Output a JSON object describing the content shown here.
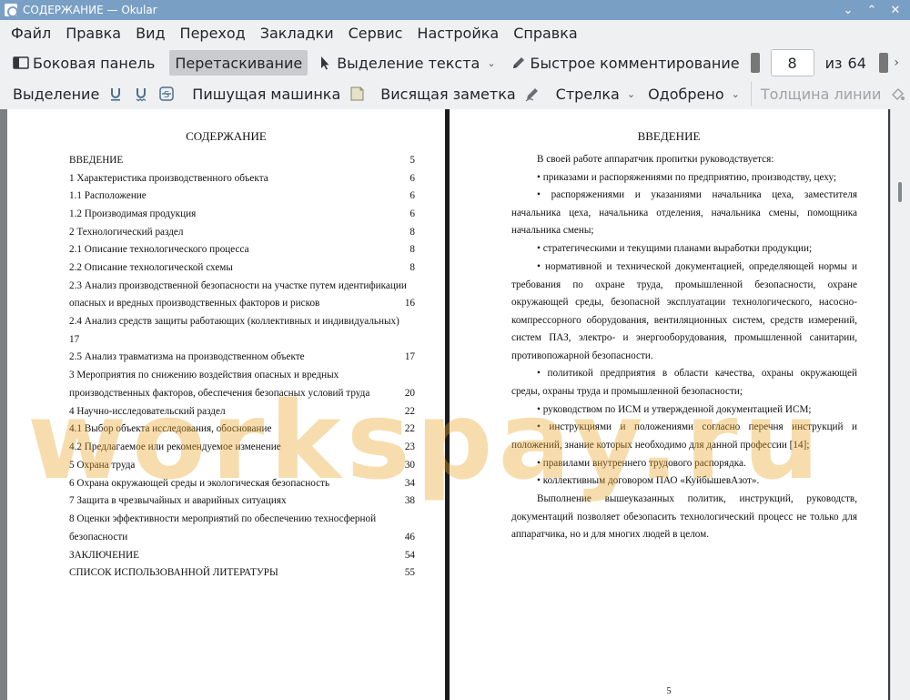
{
  "window": {
    "title": "СОДЕРЖАНИЕ  — Okular",
    "minimize": "⌄",
    "maximize": "⌃",
    "close": "✕"
  },
  "menu": [
    "Файл",
    "Правка",
    "Вид",
    "Переход",
    "Закладки",
    "Сервис",
    "Настройка",
    "Справка"
  ],
  "toolbar1": {
    "sidebar": "Боковая панель",
    "drag": "Перетаскивание",
    "text_select": "Выделение текста",
    "quick_comment": "Быстрое комментирование",
    "page_current": "8",
    "of": "из",
    "page_total": "64"
  },
  "toolbar2": {
    "selection": "Выделение",
    "typewriter": "Пишущая машинка",
    "hanging_note": "Висящая заметка",
    "arrow": "Стрелка",
    "stamp": "Одобрено",
    "line_width": "Толщина линии"
  },
  "left_page": {
    "title": "СОДЕРЖАНИЕ",
    "toc": [
      {
        "text": "ВВЕДЕНИЕ",
        "page": "5"
      },
      {
        "text": "1 Характеристика производственного объекта",
        "page": "6"
      },
      {
        "text": "1.1 Расположение",
        "page": "6"
      },
      {
        "text": "1.2 Производимая продукция",
        "page": "6"
      },
      {
        "text": "2 Технологический раздел",
        "page": "8"
      },
      {
        "text": "2.1 Описание технологического процесса",
        "page": "8"
      },
      {
        "text": "2.2 Описание технологической схемы",
        "page": "8"
      },
      {
        "text": "2.3 Анализ производственной безопасности на участке путем идентификации",
        "page": ""
      },
      {
        "text": "опасных и вредных производственных факторов и рисков",
        "page": "16"
      },
      {
        "text": "2.4 Анализ средств защиты работающих (коллективных и индивидуальных)",
        "page": ""
      },
      {
        "text": "17",
        "page": ""
      },
      {
        "text": "2.5 Анализ травматизма на производственном объекте",
        "page": "17"
      },
      {
        "text": "3 Мероприятия по снижению воздействия опасных и вредных",
        "page": ""
      },
      {
        "text": "производственных факторов, обеспечения безопасных условий труда",
        "page": "20"
      },
      {
        "text": "4 Научно-исследовательский раздел",
        "page": "22"
      },
      {
        "text": "4.1 Выбор объекта исследования, обоснование",
        "page": "22"
      },
      {
        "text": "4.2 Предлагаемое или рекомендуемое изменение",
        "page": "23"
      },
      {
        "text": "5 Охрана труда",
        "page": "30"
      },
      {
        "text": "6 Охрана окружающей среды и экологическая безопасность",
        "page": "34"
      },
      {
        "text": "7 Защита в чрезвычайных и аварийных ситуациях",
        "page": "38"
      },
      {
        "text": "8 Оценки эффективности мероприятий по обеспечению техносферной",
        "page": ""
      },
      {
        "text": "безопасности",
        "page": "46"
      },
      {
        "text": "ЗАКЛЮЧЕНИЕ",
        "page": "54"
      },
      {
        "text": "СПИСОК ИСПОЛЬЗОВАННОЙ ЛИТЕРАТУРЫ",
        "page": "55"
      }
    ]
  },
  "right_page": {
    "title": "ВВЕДЕНИЕ",
    "paragraphs": [
      "В своей работе аппаратчик пропитки руководствуется:",
      "• приказами и распоряжениями по предприятию, производству, цеху;",
      "• распоряжениями и указаниями начальника цеха, заместителя начальника цеха, начальника отделения, начальника смены, помощника начальника смены;",
      "• стратегическими и текущими планами выработки продукции;",
      "• нормативной и технической документацией, определяющей нормы и требования по охране труда, промышленной безопасности, охране окружающей среды, безопасной эксплуатации технологического, насосно-компрессорного оборудования, вентиляционных систем, средств измерений, систем ПАЗ, электро- и энергооборудования, промышленной санитарии, противопожарной безопасности.",
      "• политикой предприятия в области качества, охраны окружающей среды, охраны труда и промышленной безопасности;",
      "• руководством по ИСМ и  утвержденной документацией ИСМ;",
      "• инструкциями и положениями согласно перечня инструкций и положений, знание которых необходимо для данной профессии [14];",
      "• правилами внутреннего трудового распорядка.",
      "• коллективным договором ПАО «КуйбышевАзот».",
      "Выполнение вышеуказанных политик, инструкций, руководств, документаций позволяет обезопасить технологический процесс не только для аппаратчика, но и для многих людей в целом."
    ],
    "page_number": "5"
  },
  "watermark": "workspay.ru",
  "colors": {
    "titlebar": "#7a9fc4",
    "active_button": "#c9cbce",
    "doc_background": "#7d7f82",
    "watermark": "#eba528"
  }
}
